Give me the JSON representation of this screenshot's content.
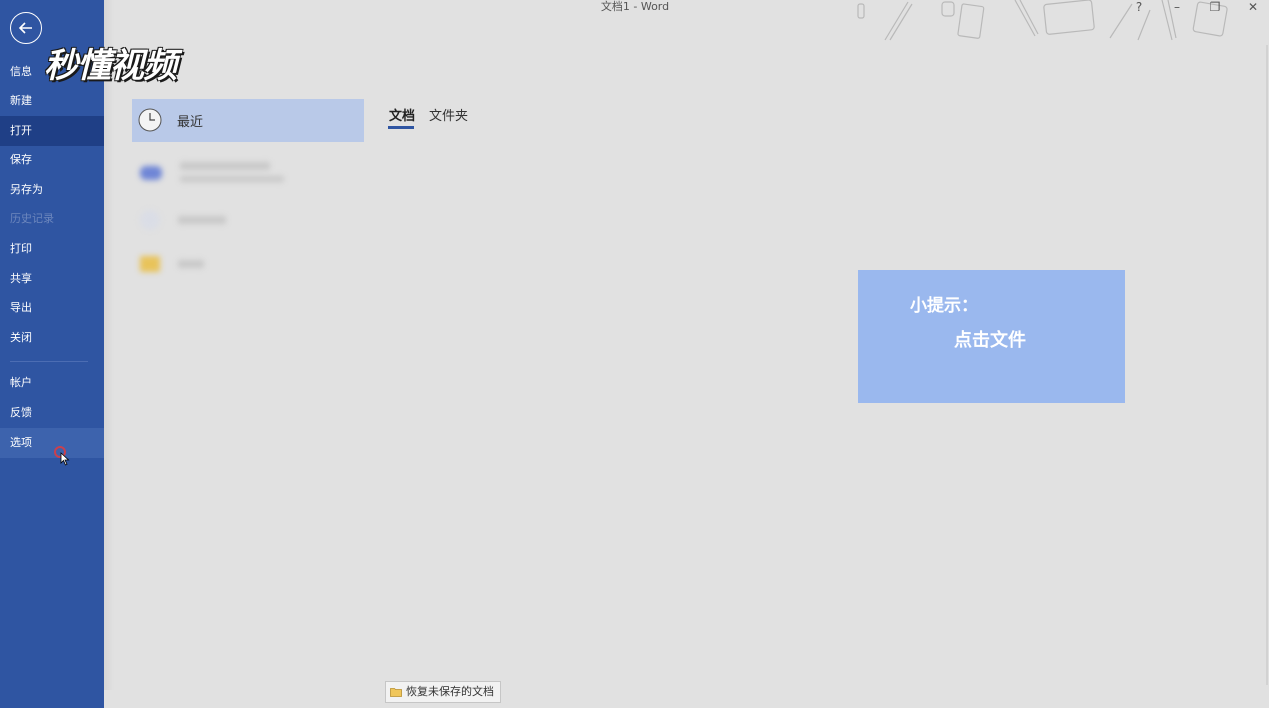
{
  "window": {
    "title": "文档1  -  Word",
    "controls": {
      "help": "?",
      "minimize": "–",
      "restore": "❐",
      "close": "✕"
    }
  },
  "logo": {
    "text": "秒懂视频"
  },
  "sidebar": {
    "items": [
      {
        "label": "信息"
      },
      {
        "label": "新建"
      },
      {
        "label": "打开"
      },
      {
        "label": "保存"
      },
      {
        "label": "另存为"
      },
      {
        "label": "历史记录"
      },
      {
        "label": "打印"
      },
      {
        "label": "共享"
      },
      {
        "label": "导出"
      },
      {
        "label": "关闭"
      },
      {
        "label": "帐户"
      },
      {
        "label": "反馈"
      },
      {
        "label": "选项"
      }
    ],
    "selected": "打开",
    "hovered": "选项",
    "disabled": "历史记录"
  },
  "locations": {
    "recent_label": "最近"
  },
  "tabs": [
    {
      "label": "文档",
      "active": true
    },
    {
      "label": "文件夹",
      "active": false
    }
  ],
  "tip": {
    "title": "小提示：",
    "text": "点击文件"
  },
  "recover_button": {
    "label": "恢复未保存的文档"
  },
  "colors": {
    "sidebar": "#2f55a2",
    "selected": "#1f3f86",
    "recent_highlight": "#b9c9e8",
    "tip_box": "#9ab8ee",
    "background": "#e1e1e1"
  }
}
